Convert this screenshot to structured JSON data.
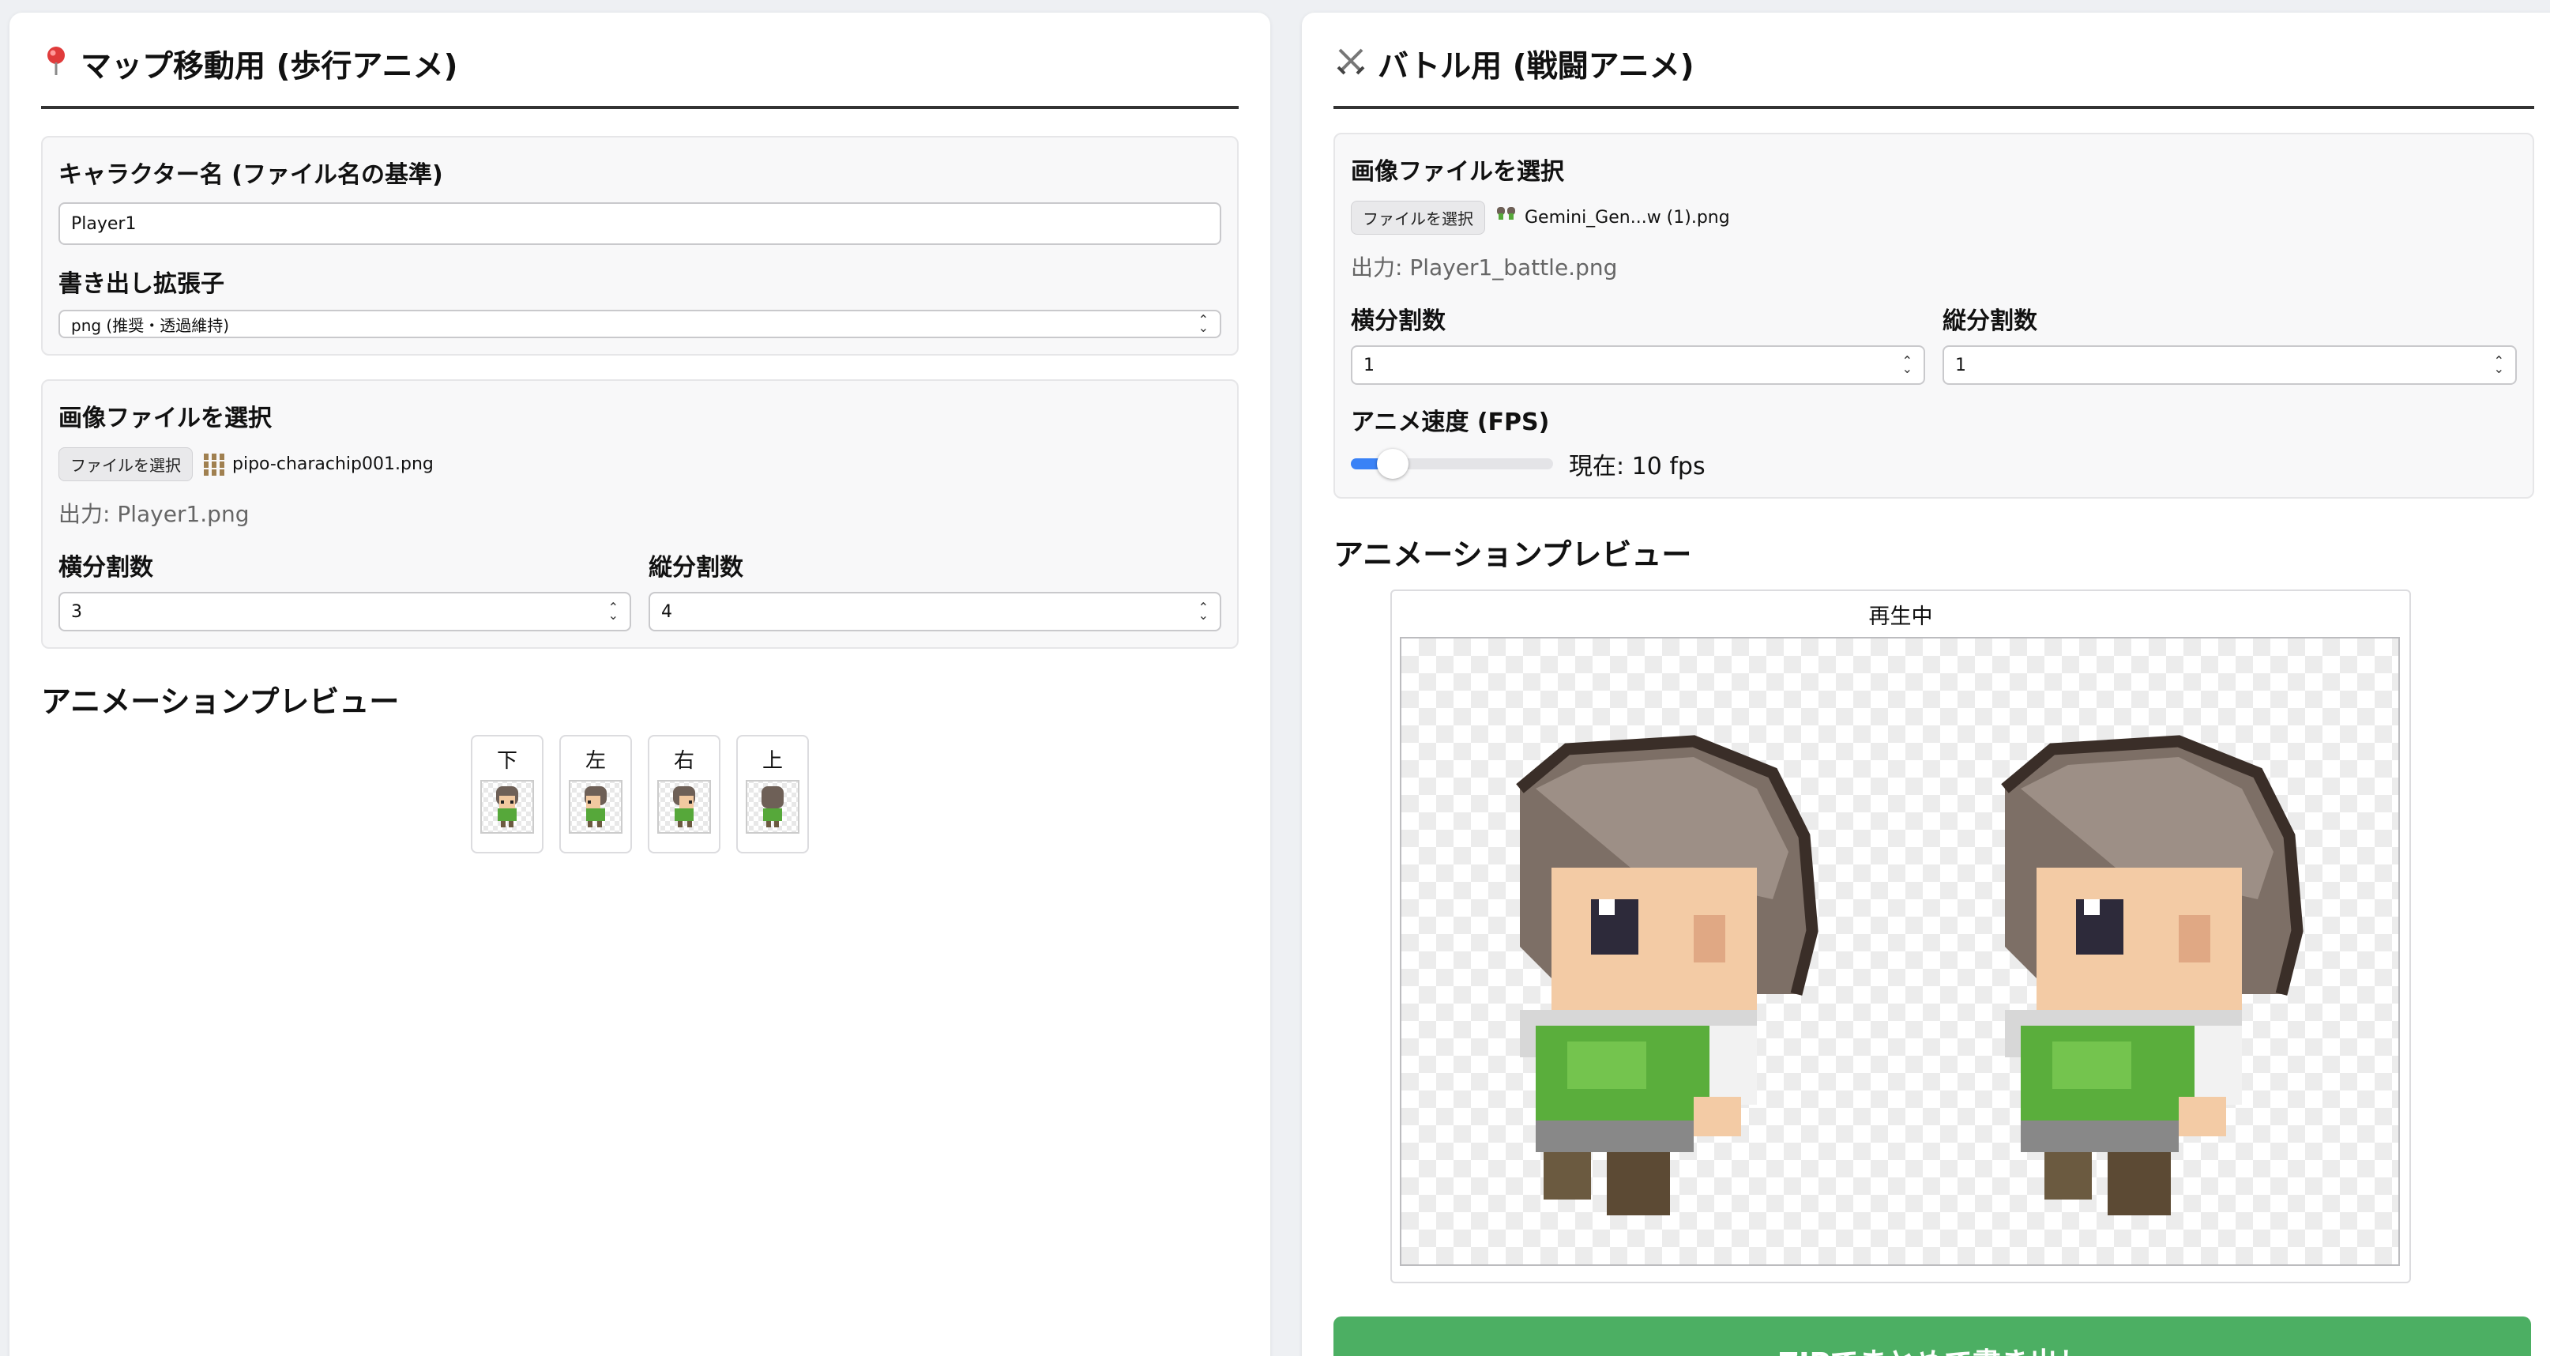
{
  "map_panel": {
    "title": "マップ移動用 (歩行アニメ)",
    "title_icon": "pin-icon",
    "char_name_label": "キャラクター名 (ファイル名の基準)",
    "char_name_value": "Player1",
    "ext_label": "書き出し拡張子",
    "ext_value": "png (推奨・透過維持)",
    "file_label": "画像ファイルを選択",
    "file_button": "ファイルを選択",
    "file_name": "pipo-charachip001.png",
    "output": "出力: Player1.png",
    "hdiv_label": "横分割数",
    "hdiv_value": "3",
    "vdiv_label": "縦分割数",
    "vdiv_value": "4",
    "preview_heading": "アニメーションプレビュー",
    "directions": [
      "下",
      "左",
      "右",
      "上"
    ]
  },
  "battle_panel": {
    "title": "バトル用 (戦闘アニメ)",
    "title_icon": "crossed-swords-icon",
    "file_label": "画像ファイルを選択",
    "file_button": "ファイルを選択",
    "file_name": "Gemini_Gen...w (1).png",
    "output": "出力: Player1_battle.png",
    "hdiv_label": "横分割数",
    "hdiv_value": "1",
    "vdiv_label": "縦分割数",
    "vdiv_value": "1",
    "fps_label": "アニメ速度 (FPS)",
    "fps_value": 10,
    "fps_fill_fraction": 0.13,
    "fps_text": "現在: 10 fps",
    "preview_heading": "アニメーションプレビュー",
    "preview_status": "再生中",
    "zip_button": "ZIPでまとめて書き出し"
  },
  "colors": {
    "accent_blue": "#3a82f6",
    "zip_green": "#4caf63"
  }
}
